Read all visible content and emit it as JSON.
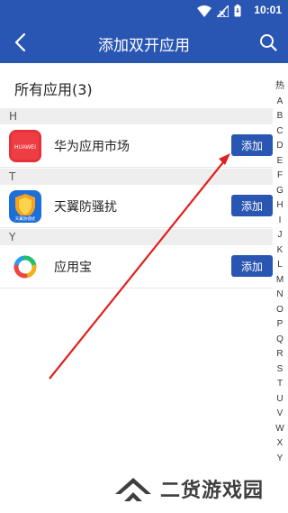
{
  "status_bar": {
    "time": "10:01"
  },
  "app_bar": {
    "title": "添加双开应用"
  },
  "list": {
    "heading": "所有应用(3)",
    "sections": [
      {
        "letter": "H",
        "app": {
          "name": "华为应用市场",
          "icon": "huawei-appgallery-icon",
          "icon_text": "HUAWEI",
          "button": "添加"
        }
      },
      {
        "letter": "T",
        "app": {
          "name": "天翼防骚扰",
          "icon": "tianyi-anti-harass-icon",
          "icon_text": "天翼防骚扰",
          "button": "添加"
        }
      },
      {
        "letter": "Y",
        "app": {
          "name": "应用宝",
          "icon": "yingyongbao-icon",
          "button": "添加"
        }
      }
    ]
  },
  "index_bar": [
    "热",
    "A",
    "B",
    "C",
    "D",
    "E",
    "F",
    "G",
    "H",
    "I",
    "J",
    "K",
    "L",
    "M",
    "N",
    "O",
    "P",
    "Q",
    "R",
    "S",
    "T",
    "U",
    "V",
    "W",
    "X",
    "Y"
  ],
  "watermark": {
    "text": "二货游戏园"
  },
  "colors": {
    "primary": "#2a56b3",
    "annotation_arrow": "#e02020"
  }
}
